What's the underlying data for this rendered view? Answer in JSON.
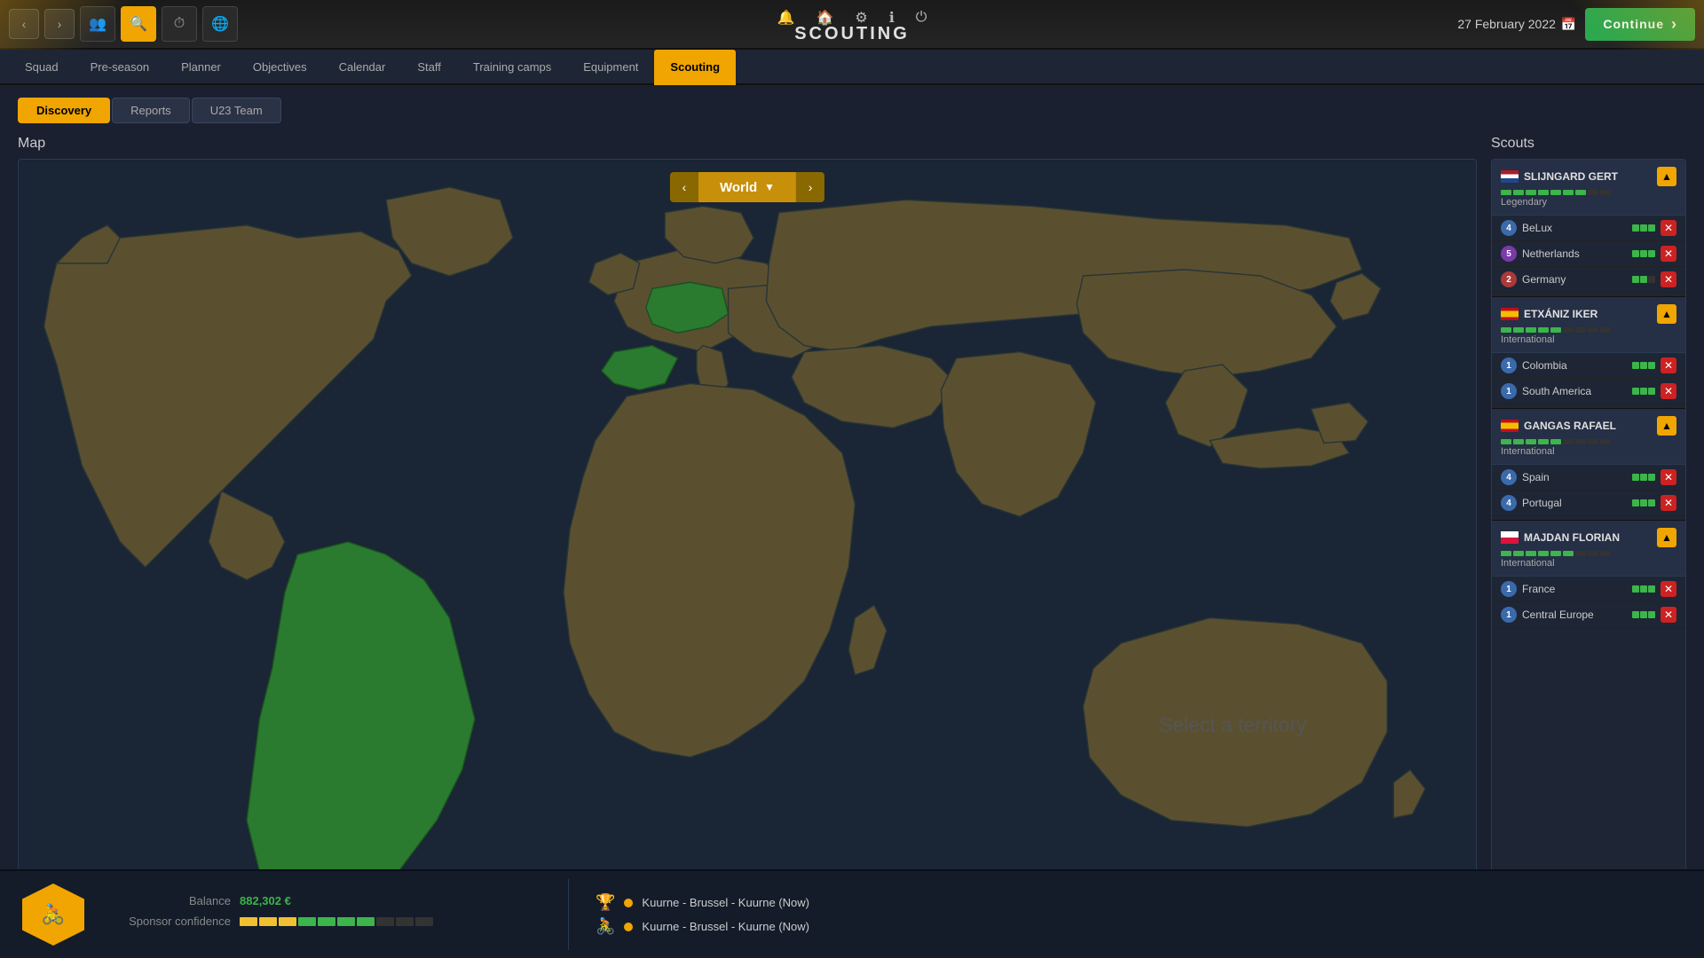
{
  "app": {
    "title": "SCOUTING",
    "date": "27 February 2022",
    "continue_label": "Continue"
  },
  "top_icons": [
    "🔔",
    "🏠",
    "⚙",
    "ℹ",
    "⏻"
  ],
  "nav_tabs": [
    {
      "label": "Squad",
      "active": false
    },
    {
      "label": "Pre-season",
      "active": false
    },
    {
      "label": "Planner",
      "active": false
    },
    {
      "label": "Objectives",
      "active": false
    },
    {
      "label": "Calendar",
      "active": false
    },
    {
      "label": "Staff",
      "active": false
    },
    {
      "label": "Training camps",
      "active": false
    },
    {
      "label": "Equipment",
      "active": false
    },
    {
      "label": "Scouting",
      "active": true
    }
  ],
  "sub_tabs": [
    {
      "label": "Discovery",
      "active": true
    },
    {
      "label": "Reports",
      "active": false
    },
    {
      "label": "U23 Team",
      "active": false
    }
  ],
  "map": {
    "section_title": "Map",
    "world_label": "World",
    "select_text": "Select a territory"
  },
  "scouts": {
    "section_title": "Scouts",
    "list": [
      {
        "id": "slijngard",
        "name": "SLIJNGARD GERT",
        "flag": "nl",
        "level": "Legendary",
        "rating": 7,
        "max_rating": 9,
        "assignments": [
          {
            "num": 4,
            "badge": "badge-4",
            "name": "BeLux",
            "bars": 3
          },
          {
            "num": 5,
            "badge": "badge-5",
            "name": "Netherlands",
            "bars": 3
          },
          {
            "num": 2,
            "badge": "badge-2",
            "name": "Germany",
            "bars": 2
          }
        ]
      },
      {
        "id": "etxaniz",
        "name": "ETXÁNIZ IKER",
        "flag": "es",
        "level": "International",
        "rating": 5,
        "max_rating": 9,
        "assignments": [
          {
            "num": 1,
            "badge": "badge-1",
            "name": "Colombia",
            "bars": 3
          },
          {
            "num": 1,
            "badge": "badge-1",
            "name": "South America",
            "bars": 3
          }
        ]
      },
      {
        "id": "gangas",
        "name": "GANGAS RAFAEL",
        "flag": "es",
        "level": "International",
        "rating": 5,
        "max_rating": 9,
        "assignments": [
          {
            "num": 4,
            "badge": "badge-4",
            "name": "Spain",
            "bars": 3
          },
          {
            "num": 4,
            "badge": "badge-4",
            "name": "Portugal",
            "bars": 3
          }
        ]
      },
      {
        "id": "majdan",
        "name": "MAJDAN FLORIAN",
        "flag": "pl",
        "level": "International",
        "rating": 6,
        "max_rating": 9,
        "assignments": [
          {
            "num": 1,
            "badge": "badge-1",
            "name": "France",
            "bars": 3
          },
          {
            "num": 1,
            "badge": "badge-1",
            "name": "Central Europe",
            "bars": 3
          }
        ]
      }
    ]
  },
  "bottom": {
    "balance_label": "Balance",
    "balance_value": "882,302 €",
    "sponsor_label": "Sponsor confidence",
    "events": [
      {
        "icon": "trophy",
        "dot_color": "#f0a500",
        "text": "Kuurne - Brussel - Kuurne (Now)"
      },
      {
        "icon": "riders",
        "dot_color": "#f0a500",
        "text": "Kuurne - Brussel - Kuurne (Now)"
      }
    ]
  }
}
